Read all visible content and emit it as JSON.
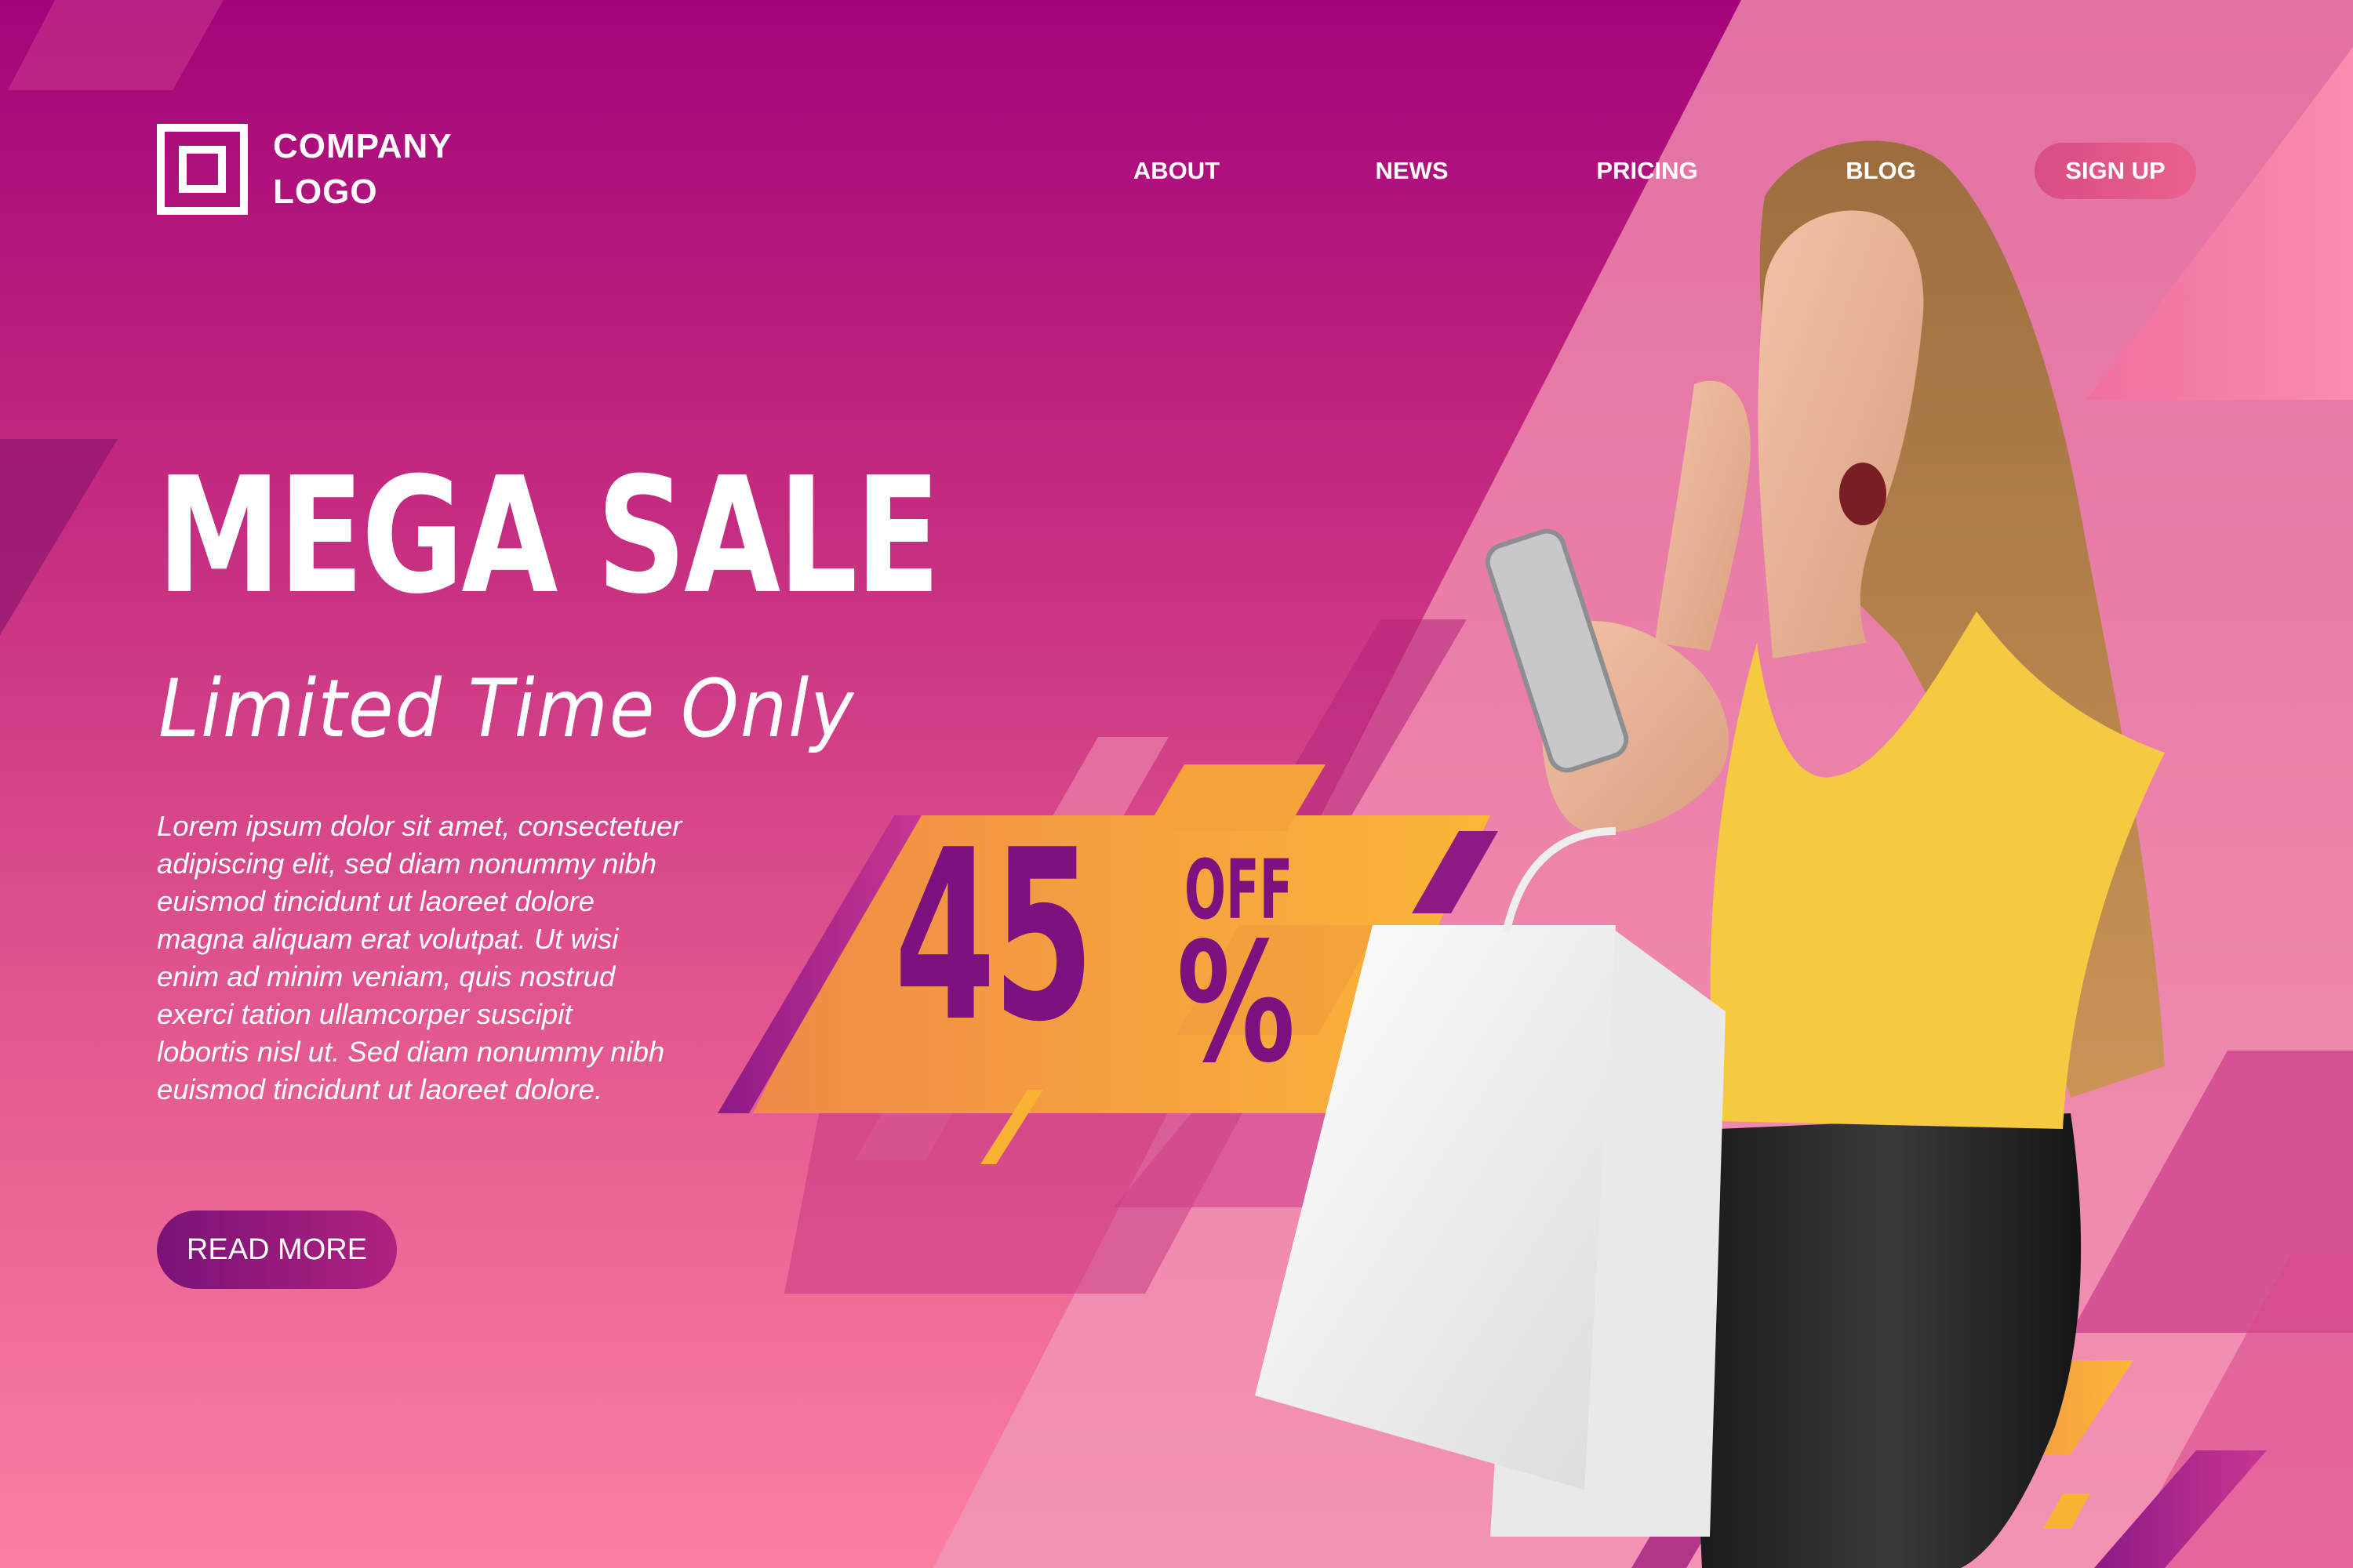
{
  "header": {
    "logo": {
      "line1": "COMPANY",
      "line2": "LOGO",
      "icon": "square-logo-icon"
    },
    "nav": [
      {
        "label": "ABOUT"
      },
      {
        "label": "NEWS"
      },
      {
        "label": "PRICING"
      },
      {
        "label": "BLOG"
      }
    ],
    "signup_label": "SIGN UP"
  },
  "hero": {
    "title": "MEGA SALE",
    "subtitle": "Limited Time Only",
    "body_lines": [
      "Lorem ipsum dolor sit amet, consectetuer",
      "adipiscing elit, sed diam nonummy nibh",
      "euismod tincidunt ut laoreet dolore",
      "magna aliquam erat volutpat. Ut wisi",
      "enim ad minim veniam, quis nostrud",
      "exerci tation ullamcorper suscipit",
      "lobortis nisl ut. Sed diam nonummy nibh",
      "euismod tincidunt ut laoreet dolore."
    ],
    "cta_label": "READ MORE"
  },
  "badge": {
    "number": "45",
    "off": "OFF",
    "percent": "%"
  },
  "colors": {
    "background_top": "#a3047a",
    "background_bottom": "#fb80a2",
    "badge_orange": "#f9b233",
    "badge_text": "#7d1180",
    "signup_pink": "#e2588e"
  }
}
